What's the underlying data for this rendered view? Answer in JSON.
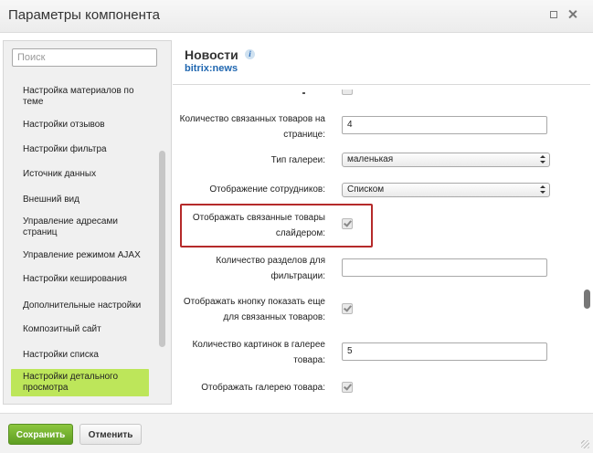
{
  "window": {
    "title": "Параметры компонента"
  },
  "sidebar": {
    "search_placeholder": "Поиск",
    "items": [
      {
        "label": "Настройка материалов по теме"
      },
      {
        "label": "Настройки отзывов"
      },
      {
        "label": "Настройки фильтра"
      },
      {
        "label": "Источник данных"
      },
      {
        "label": "Внешний вид"
      },
      {
        "label": "Управление адресами страниц"
      },
      {
        "label": "Управление режимом AJAX"
      },
      {
        "label": "Настройки кеширования"
      },
      {
        "label": "Дополнительные настройки"
      },
      {
        "label": "Композитный сайт"
      },
      {
        "label": "Настройки списка"
      },
      {
        "label": "Настройки детального просмотра",
        "active": true
      }
    ]
  },
  "content": {
    "title": "Новости",
    "info_icon": "info-icon",
    "subtitle": "bitrix:news",
    "fields": [
      {
        "label": "Количество связанных товаров на странице:",
        "type": "text",
        "value": "4"
      },
      {
        "label": "Тип галереи:",
        "type": "select",
        "value": "маленькая"
      },
      {
        "label": "Отображение сотрудников:",
        "type": "select",
        "value": "Списком"
      },
      {
        "label": "Отображать связанные товары слайдером:",
        "type": "checkbox",
        "checked": true
      },
      {
        "label": "Количество разделов для фильтрации:",
        "type": "text",
        "value": ""
      },
      {
        "label": "Отображать кнопку показать еще для связанных товаров:",
        "type": "checkbox",
        "checked": true
      },
      {
        "label": "Количество картинок в галерее товара:",
        "type": "text",
        "value": "5"
      },
      {
        "label": "Отображать галерею товара:",
        "type": "checkbox",
        "checked": true
      }
    ]
  },
  "footer": {
    "save_label": "Сохранить",
    "cancel_label": "Отменить"
  },
  "colors": {
    "accent_green": "#8cc63f",
    "active_item": "#bde65a",
    "link_blue": "#2067b0",
    "highlight_red": "#b52a2a"
  }
}
